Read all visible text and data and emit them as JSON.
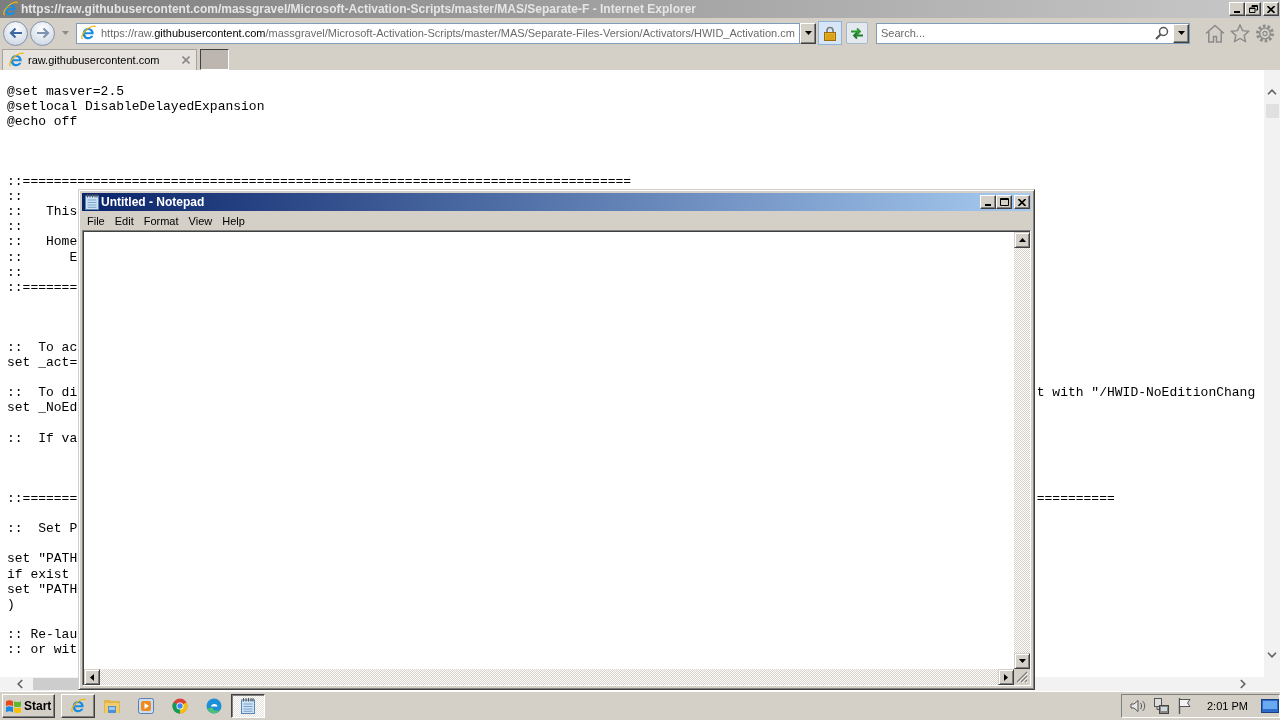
{
  "browser": {
    "title": "https://raw.githubusercontent.com/massgravel/Microsoft-Activation-Scripts/master/MAS/Separate-F - Internet Explorer",
    "active": false
  },
  "address_bar": {
    "prefix": "https://raw.",
    "domain": "githubusercontent.com",
    "path": "/massgravel/Microsoft-Activation-Scripts/master/MAS/Separate-Files-Version/Activators/HWID_Activation.cm"
  },
  "search": {
    "placeholder": "Search..."
  },
  "tabs": [
    {
      "label": "raw.githubusercontent.com",
      "selected": true
    }
  ],
  "page": {
    "lines": [
      {
        "kind": "text",
        "text": "@set masver=2.5"
      },
      {
        "kind": "text",
        "text": "@setlocal DisableDelayedExpansion"
      },
      {
        "kind": "text",
        "text": "@echo off"
      },
      {
        "kind": "blank"
      },
      {
        "kind": "blank"
      },
      {
        "kind": "blank"
      },
      {
        "kind": "text",
        "text": "::=============================================================================="
      },
      {
        "kind": "text",
        "text": "::"
      },
      {
        "kind": "text",
        "text": "::   This"
      },
      {
        "kind": "text",
        "text": "::"
      },
      {
        "kind": "text",
        "text": "::   Home"
      },
      {
        "kind": "text",
        "text": "::      E"
      },
      {
        "kind": "text",
        "text": "::"
      },
      {
        "kind": "text",
        "text": "::======="
      },
      {
        "kind": "blank"
      },
      {
        "kind": "blank"
      },
      {
        "kind": "blank"
      },
      {
        "kind": "text",
        "text": "::  To ac"
      },
      {
        "kind": "text",
        "text": "set _act="
      },
      {
        "kind": "blank"
      },
      {
        "kind": "text",
        "text": "::  To di",
        "right": "t with \"/HWID-NoEditionChang"
      },
      {
        "kind": "text",
        "text": "set _NoEd"
      },
      {
        "kind": "blank"
      },
      {
        "kind": "text",
        "text": "::  If va"
      },
      {
        "kind": "blank"
      },
      {
        "kind": "blank"
      },
      {
        "kind": "blank"
      },
      {
        "kind": "text",
        "text": "::=======",
        "right": "=========="
      },
      {
        "kind": "blank"
      },
      {
        "kind": "text",
        "text": "::  Set P"
      },
      {
        "kind": "blank"
      },
      {
        "kind": "text",
        "text": "set \"PATH"
      },
      {
        "kind": "text",
        "text": "if exist"
      },
      {
        "kind": "text",
        "text": "set \"PATH"
      },
      {
        "kind": "text",
        "text": ")"
      },
      {
        "kind": "blank"
      },
      {
        "kind": "text",
        "text": ":: Re-lau"
      },
      {
        "kind": "text",
        "text": ":: or wit"
      }
    ]
  },
  "notepad": {
    "title": "Untitled - Notepad",
    "active": true,
    "menu": [
      "File",
      "Edit",
      "Format",
      "View",
      "Help"
    ]
  },
  "taskbar": {
    "start": "Start",
    "items": [
      {
        "open": true,
        "selected": false
      },
      {
        "open": false,
        "selected": false
      },
      {
        "open": false,
        "selected": false
      },
      {
        "open": false,
        "selected": false
      },
      {
        "open": false,
        "selected": false
      },
      {
        "open": true,
        "selected": true
      }
    ],
    "clock": "2:01 PM"
  }
}
